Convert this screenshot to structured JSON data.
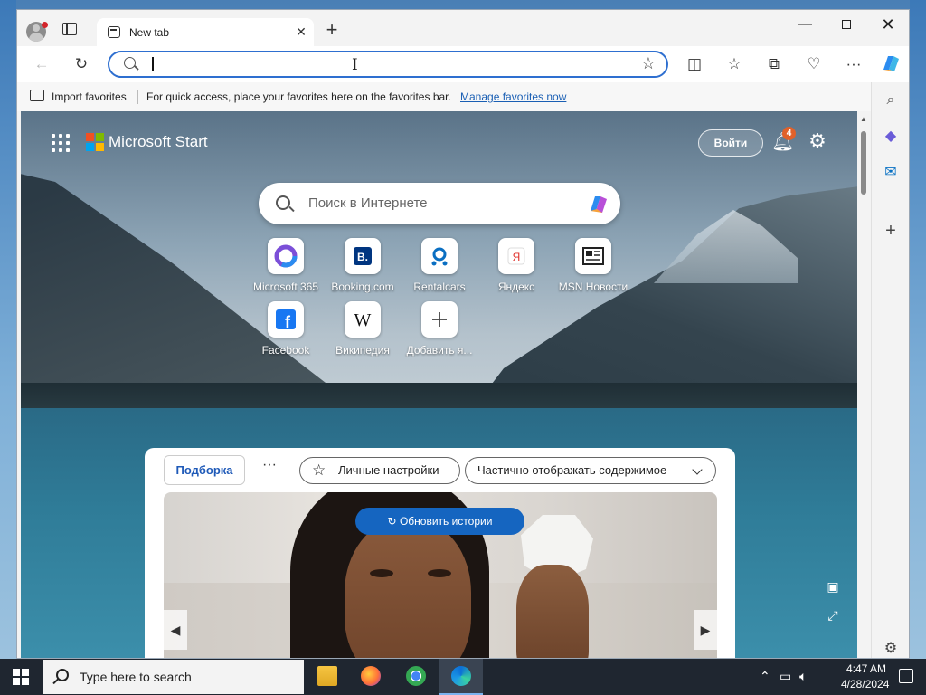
{
  "browser": {
    "tab": {
      "title": "New tab"
    },
    "address": {
      "value": ""
    },
    "favorites_bar": {
      "import_label": "Import favorites",
      "hint": "For quick access, place your favorites here on the favorites bar.",
      "manage_link": "Manage favorites now"
    },
    "icons": {
      "back": "back-arrow-icon",
      "reload": "reload-icon",
      "star": "star-icon",
      "split": "split-screen-icon",
      "favorites": "favorites-icon",
      "collections": "collections-icon",
      "health": "browser-essentials-icon",
      "more": "more-icon",
      "copilot": "copilot-icon"
    }
  },
  "page": {
    "brand": "Microsoft Start",
    "login_label": "Войти",
    "notifications_count": "4",
    "search_placeholder": "Поиск в Интернете",
    "quick_links": [
      {
        "label": "Microsoft 365"
      },
      {
        "label": "Booking.com"
      },
      {
        "label": "Rentalcars"
      },
      {
        "label": "Яндекс"
      },
      {
        "label": "MSN Новости"
      },
      {
        "label": "Facebook"
      },
      {
        "label": "Википедия"
      },
      {
        "label": "Добавить я..."
      }
    ],
    "feed": {
      "tab_label": "Подборка",
      "more_label": "···",
      "personalize_label": "Личные настройки",
      "content_mode_label": "Частично отображать содержимое",
      "refresh_label": "Обновить истории"
    }
  },
  "taskbar": {
    "search_text": "Type here to search",
    "time": "4:47 AM",
    "date": "4/28/2024"
  },
  "colors": {
    "accent": "#2e6fd0",
    "feed_tab": "#1f5ab8",
    "refresh_button": "#1565c0",
    "badge": "#e0612a"
  }
}
